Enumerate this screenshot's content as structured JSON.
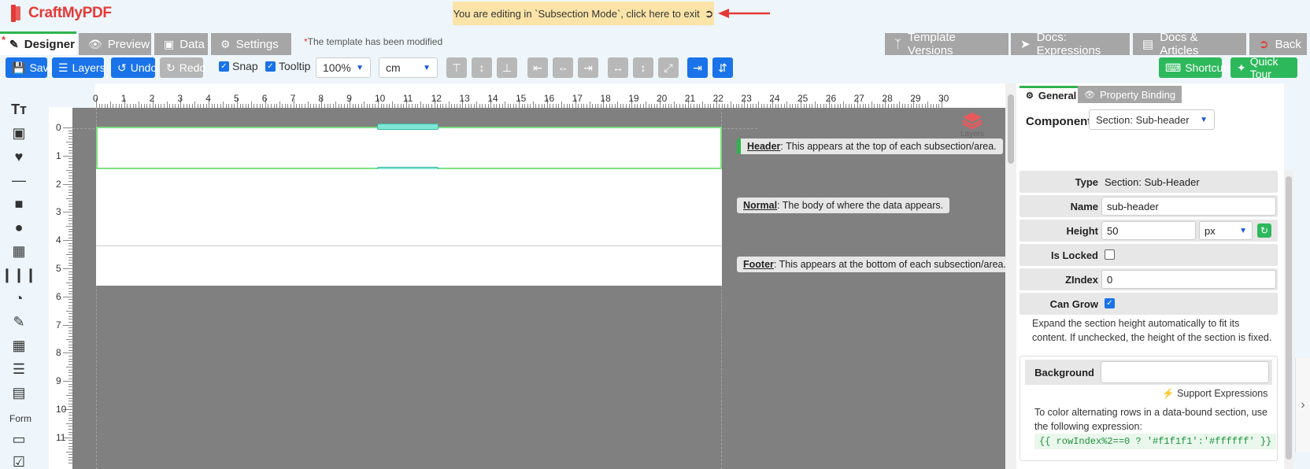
{
  "app": {
    "logo_text": "CraftMyPDF"
  },
  "banner": {
    "text": "You are editing in `Subsection Mode`, click here to exit"
  },
  "tabs": [
    {
      "label": "Designer",
      "icon": "pencil-icon"
    },
    {
      "label": "Preview",
      "icon": "eye-icon"
    },
    {
      "label": "Data",
      "icon": "database-icon"
    },
    {
      "label": "Settings",
      "icon": "gears-icon"
    }
  ],
  "modified_note": "The template has been modified",
  "right_tabs": [
    {
      "label": "Template Versions",
      "icon": "branch-icon"
    },
    {
      "label": "Docs: Expressions",
      "icon": "rocket-icon"
    },
    {
      "label": "Docs & Articles",
      "icon": "book-icon"
    },
    {
      "label": "Back",
      "icon": "exit-icon"
    }
  ],
  "toolbar": {
    "save": "Save",
    "layers": "Layers",
    "undo": "Undo",
    "redo": "Redo",
    "snap": "Snap",
    "tooltip": "Tooltip",
    "zoom": "100%",
    "unit": "cm",
    "shortcuts": "Shortcuts",
    "quick_tour": "Quick Tour"
  },
  "ruler": {
    "horizontal": [
      "0",
      "1",
      "2",
      "3",
      "4",
      "5",
      "6",
      "7",
      "8",
      "9",
      "10",
      "11",
      "12",
      "13",
      "14",
      "15",
      "16",
      "17",
      "18",
      "19",
      "20",
      "21",
      "22",
      "23",
      "24",
      "25",
      "26",
      "27",
      "28",
      "29",
      "30"
    ],
    "vertical": [
      "0",
      "1",
      "2",
      "3",
      "4",
      "5",
      "6",
      "7",
      "8",
      "9",
      "10",
      "11"
    ]
  },
  "palette": {
    "form_label": "Form",
    "items": [
      "text-icon",
      "image-icon",
      "heart-icon",
      "line-icon",
      "rectangle-icon",
      "circle-icon",
      "qrcode-icon",
      "barcode-icon",
      "chart-icon",
      "rich-text-icon",
      "table-icon",
      "list-icon",
      "container-icon",
      "textbox-icon",
      "checkbox-icon"
    ]
  },
  "canvas": {
    "layers_label": "Layers",
    "hints": [
      {
        "term": "Header",
        "text": ": This appears at the top of each subsection/area."
      },
      {
        "term": "Normal",
        "text": ": The body of where the data appears."
      },
      {
        "term": "Footer",
        "text": ": This appears at the bottom of each subsection/area."
      }
    ]
  },
  "panel": {
    "tab_general": "General",
    "tab_binding": "Property Binding",
    "component_label": "Component:",
    "component_value": "Section: Sub-header",
    "rows": {
      "type_label": "Type",
      "type_value": "Section: Sub-Header",
      "name_label": "Name",
      "name_value": "sub-header",
      "height_label": "Height",
      "height_value": "50",
      "height_unit": "px",
      "locked_label": "Is Locked",
      "zindex_label": "ZIndex",
      "zindex_value": "0",
      "grow_label": "Can Grow"
    },
    "grow_description": "Expand the section height automatically to fit its content. If unchecked, the height of the section is fixed.",
    "background_label": "Background",
    "support_expressions": "Support Expressions",
    "tip": "To color alternating rows in a data-bound section, use the following expression:",
    "expression": "{{ rowIndex%2==0 ? '#f1f1f1':'#ffffff' }}"
  },
  "colors": {
    "accent": "#1a73e8",
    "green": "#2eb85c",
    "brand": "#e53935",
    "banner": "#fce4a8"
  }
}
